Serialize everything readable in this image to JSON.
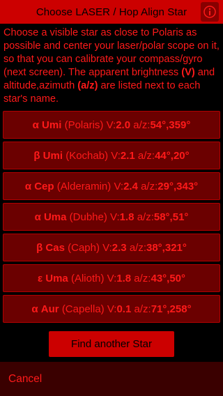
{
  "header": {
    "title": "Choose LASER / Hop Align Star",
    "info_icon": "info-icon"
  },
  "instructions": {
    "part1": "Choose a visible star as close to Polaris as possible and center your laser/polar scope on it, so that you can calibrate your compass/gyro (next screen). The apparent brightness ",
    "v_label": "(V)",
    "part2": " and altitude,azimuth ",
    "az_label": "(a/z)",
    "part3": " are listed next to each star's name."
  },
  "stars": [
    {
      "symbol": "α Umi",
      "name": "(Polaris)",
      "v_label": "V:",
      "v": "2.0",
      "az_label": "a/z:",
      "az": "54°,359°"
    },
    {
      "symbol": "β Umi",
      "name": "(Kochab)",
      "v_label": "V:",
      "v": "2.1",
      "az_label": "a/z:",
      "az": "44°,20°"
    },
    {
      "symbol": "α Cep",
      "name": "(Alderamin)",
      "v_label": "V:",
      "v": "2.4",
      "az_label": "a/z:",
      "az": "29°,343°"
    },
    {
      "symbol": "α Uma",
      "name": "(Dubhe)",
      "v_label": "V:",
      "v": "1.8",
      "az_label": "a/z:",
      "az": "58°,51°"
    },
    {
      "symbol": "β Cas",
      "name": "(Caph)",
      "v_label": "V:",
      "v": "2.3",
      "az_label": "a/z:",
      "az": "38°,321°"
    },
    {
      "symbol": "ε Uma",
      "name": "(Alioth)",
      "v_label": "V:",
      "v": "1.8",
      "az_label": "a/z:",
      "az": "43°,50°"
    },
    {
      "symbol": "α Aur",
      "name": "(Capella)",
      "v_label": "V:",
      "v": "0.1",
      "az_label": "a/z:",
      "az": "71°,258°"
    }
  ],
  "find_button": "Find another Star",
  "cancel_button": "Cancel",
  "colors": {
    "accent": "#cc0000",
    "text": "#ff1a1a",
    "button_bg": "#6b0000",
    "bottom_bar": "#3a0000"
  }
}
